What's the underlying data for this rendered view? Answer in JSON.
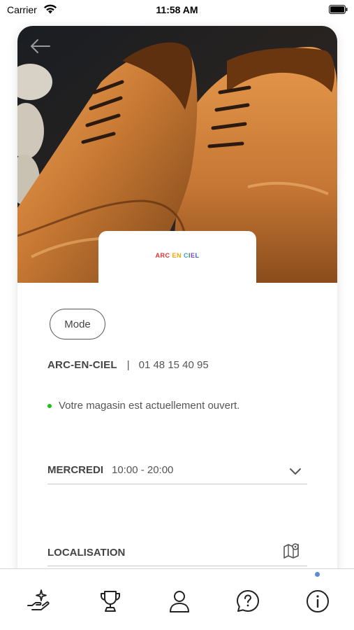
{
  "status_bar": {
    "carrier": "Carrier",
    "time": "11:58 AM"
  },
  "store": {
    "logo_letters": [
      "A",
      "R",
      "C",
      " ",
      "E",
      "N",
      " ",
      "C",
      "I",
      "E",
      "L"
    ],
    "logo_colors": [
      "#e03030",
      "#e03030",
      "#e03030",
      "#ffffff",
      "#f0a800",
      "#f0a800",
      "#ffffff",
      "#38a0d8",
      "#2a8a3a",
      "#8a40c0",
      "#3a60c8"
    ],
    "category": "Mode",
    "name": "ARC-EN-CIEL",
    "separator": "|",
    "phone": "01 48 15 40 95",
    "open_status": "Votre magasin est actuellement ouvert.",
    "open_color": "#19c219"
  },
  "hours": {
    "day": "MERCREDI",
    "time": "10:00 - 20:00"
  },
  "location": {
    "title": "LOCALISATION"
  },
  "tabs": [
    {
      "icon": "sparkle-hand-icon"
    },
    {
      "icon": "trophy-icon"
    },
    {
      "icon": "user-icon"
    },
    {
      "icon": "help-icon"
    },
    {
      "icon": "info-icon"
    }
  ],
  "colors": {
    "accent_dot": "#5b8bd6"
  }
}
